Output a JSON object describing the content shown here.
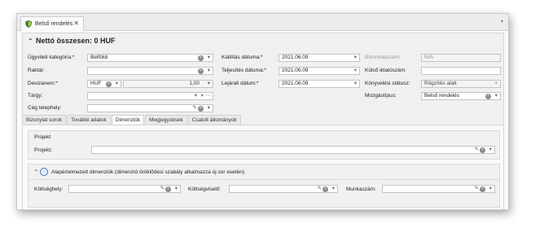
{
  "tab": {
    "title": "Belső rendelés",
    "close": "✕",
    "menu": "▾"
  },
  "summary": {
    "title": "Nettó összesen: 0 HUF"
  },
  "form": {
    "ugyviteli_label": "Ügyviteli kategória:*",
    "ugyviteli_value": "Belföldi",
    "raktar_label": "Raktár:",
    "raktar_value": "",
    "devizanem_label": "Devizanem:*",
    "devizanem_value": "HUF",
    "arfolyam_value": "1,00",
    "targy_label": "Tárgy:",
    "targy_value": "",
    "ceg_label": "Cég telephely:",
    "ceg_value": "",
    "kiallitas_label": "Kiállítás dátuma:*",
    "kiallitas_value": "2021.06.09",
    "teljesites_label": "Teljesítés dátuma:*",
    "teljesites_value": "2021.06.09",
    "lejarati_label": "Lejárati dátum:*",
    "lejarati_value": "2021.06.09",
    "bizonylatszam_label": "Bizonylatszám:",
    "bizonylatszam_value": "N/A",
    "kulso_label": "Külső iktatószám:",
    "kulso_value": "",
    "konyvelesi_label": "Könyvelési státusz:",
    "konyvelesi_value": "Rögzítés alatt",
    "mozgastipus_label": "Mozgástípus:",
    "mozgastipus_value": "Belső rendelés"
  },
  "subtabs": [
    "Bizonylat sorok",
    "További adatok",
    "Dimenziók",
    "Megjegyzések",
    "Csatolt állományok"
  ],
  "dimensions": {
    "projekt_group": "Projekt",
    "projekt_label": "Projekt:",
    "projekt_value": "",
    "default_title": "Alapértelmezett dimenziók (dimenzió öröklődési szabály alkalmazza új sor esetén)",
    "koltseghely_label": "Költséghely:",
    "koltsegvisel_label": "Költségviselő:",
    "munkaszam_label": "Munkaszám:"
  },
  "icons": {
    "pencil": "✎",
    "dropdown": "▾",
    "clear": "×",
    "more": "⋯",
    "collapse": "⌃",
    "down": "↓"
  }
}
